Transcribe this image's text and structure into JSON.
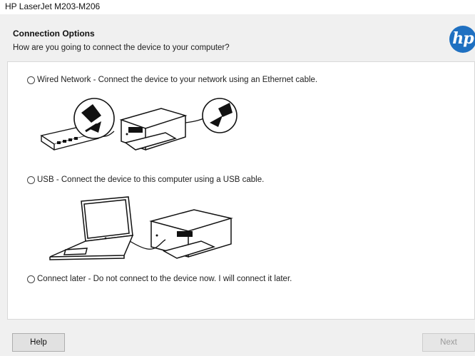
{
  "window": {
    "title": "HP LaserJet M203-M206"
  },
  "header": {
    "title": "Connection Options",
    "subtitle": "How are you going to connect the device to your computer?",
    "logo_text": "hp"
  },
  "options": [
    {
      "label": "Wired Network - Connect the device to your network using an Ethernet cable.",
      "selected": false
    },
    {
      "label": "USB - Connect the device to this computer using a USB cable.",
      "selected": false
    },
    {
      "label": "Connect later - Do not connect to the device now. I will connect it later.",
      "selected": false
    }
  ],
  "footer": {
    "help_label": "Help",
    "next_label": "Next",
    "next_enabled": false
  },
  "colors": {
    "hp_blue": "#1f70c1",
    "content_bg": "#ffffff",
    "dialog_bg": "#f0f0f0"
  }
}
